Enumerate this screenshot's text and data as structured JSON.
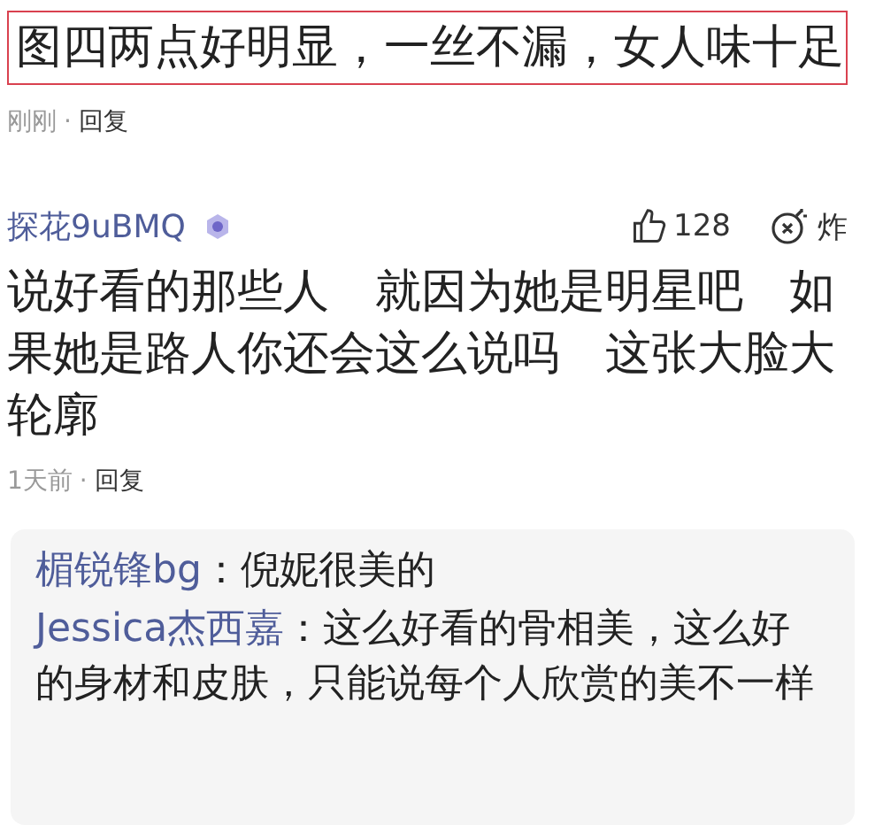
{
  "highlighted_comment": {
    "text": "图四两点好明显，一丝不漏，女人味十足",
    "time": "刚刚",
    "separator": "·",
    "reply_action": "回复"
  },
  "comment": {
    "author": "探花9uBMQ",
    "likes": "128",
    "bomb_label": "炸",
    "text": "说好看的那些人　就因为她是明星吧　如果她是路人你还会这么说吗　这张大脸大轮廓",
    "time": "1天前",
    "separator": "·",
    "reply_action": "回复",
    "replies": [
      {
        "author": "楣锐锋bg",
        "colon": "：",
        "text": "倪妮很美的"
      },
      {
        "author": "Jessica杰西嘉",
        "colon": "：",
        "text": "这么好看的骨相美，这么好的身材和皮肤，只能说每个人欣赏的美不一样"
      }
    ]
  }
}
